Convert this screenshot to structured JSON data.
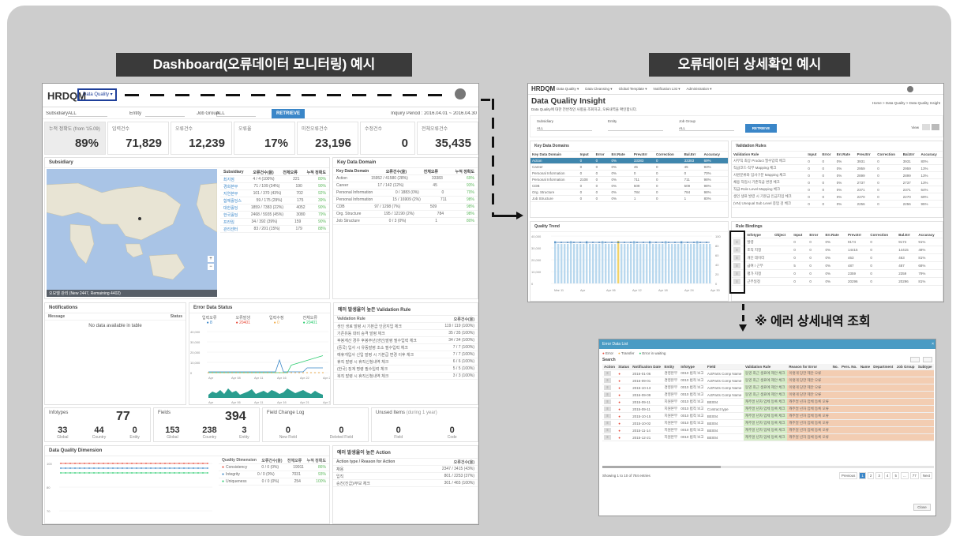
{
  "labels": {
    "left_title": "Dashboard(오류데이터 모니터링) 예시",
    "right_title": "오류데이터 상세확인 예시",
    "error_detail": "※ 에러 상세내역 조회"
  },
  "dashboard": {
    "logo": "HRDQM",
    "menu_selected": "Data Quality",
    "filters": {
      "subsidiary_label": "Subsidiary",
      "subsidiary_value": "ALL",
      "entity_label": "Entity",
      "jobgroup_label": "Job Group",
      "jobgroup_value": "ALL",
      "retrieve": "RETRIEVE",
      "period": "Inquiry Period : 2016.04.01 ~ 2016.04.30"
    },
    "kpis": [
      {
        "label": "누적 정확도 (from '15.09)",
        "value": "89%"
      },
      {
        "label": "입력건수",
        "value": "71,829"
      },
      {
        "label": "오류건수",
        "value": "12,239"
      },
      {
        "label": "오류율",
        "value": "17%"
      },
      {
        "label": "미전오류건수",
        "value": "23,196"
      },
      {
        "label": "수정건수",
        "value": "0"
      },
      {
        "label": "전체오류건수",
        "value": "35,435"
      }
    ],
    "subsidiary_panel": "Subsidiary",
    "map_status": "오모델 관리 (New 2447, Remaining 4402)",
    "subsidiary_table": {
      "headers": [
        "Subsidiary",
        "오류건수(율)",
        "전체오류",
        "누적 정확도"
      ],
      "rows": [
        [
          "최지점",
          "4 / 4 (100%)",
          "221",
          "80%"
        ],
        [
          "경희본부",
          "71 / 109 (34%)",
          "190",
          "90%"
        ],
        [
          "지연본부",
          "101 / 370 (43%)",
          "702",
          "92%"
        ],
        [
          "함께홀딩스",
          "59 / 175 (29%)",
          "175",
          "39%"
        ],
        [
          "대한홀딩",
          "1859 / 7383 (22%)",
          "4052",
          "90%"
        ],
        [
          "한국홀딩",
          "2468 / 5935 (45%)",
          "3080",
          "79%"
        ],
        [
          "프라임",
          "34 / 392 (39%)",
          "159",
          "90%"
        ],
        [
          "관리센터",
          "83 / 201 (15%)",
          "179",
          "88%"
        ]
      ]
    },
    "key_domain_panel": "Key Data Domain",
    "key_domain_table": {
      "headers": [
        "Key Data Domain",
        "오류건수(율)",
        "전체오류",
        "누적 정확도"
      ],
      "rows": [
        [
          "Action",
          "15952 / 41580 (28%)",
          "33383",
          "69%"
        ],
        [
          "Career",
          "17 / 142 (12%)",
          "45",
          "93%"
        ],
        [
          "Personal Information",
          "0 / 1883 (0%)",
          "0",
          "70%"
        ],
        [
          "Personal Information",
          "15 / 16909 (2%)",
          "711",
          "98%"
        ],
        [
          "CDB",
          "97 / 1298 (7%)",
          "509",
          "98%"
        ],
        [
          "Org. Structure",
          "195 / 12190 (2%)",
          "784",
          "98%"
        ],
        [
          "Job Structure",
          "0 / 3 (0%)",
          "1",
          "80%"
        ]
      ]
    },
    "notifications": {
      "title": "Notifications",
      "col1": "Message",
      "col2": "Status",
      "empty": "No data available in table"
    },
    "error_status": {
      "title": "Error Data Status",
      "legend": [
        {
          "name": "입력오류",
          "value": "8",
          "color": "#3a86c8"
        },
        {
          "name": "오류발생",
          "value": "20401",
          "color": "#e74c3c"
        },
        {
          "name": "입력수정",
          "value": "0",
          "color": "#f0ad4e"
        },
        {
          "name": "전체오류",
          "value": "20401",
          "color": "#2ecc71"
        }
      ],
      "yticks": [
        "40,000",
        "30,000",
        "20,000",
        "10,000",
        "0"
      ],
      "xticks": [
        "Apr",
        "Apr 08",
        "Apr 11",
        "Apr 16",
        "Apr 22",
        "Apr 28"
      ],
      "xticks2": [
        "Apr",
        "Apr 06",
        "Apr 11",
        "Apr 16",
        "Apr 21",
        "Apr 26"
      ]
    },
    "validation": {
      "title": "예러 발생율이 높은 Validation Rule",
      "col1": "Validation Rule",
      "col2": "오류건수(율)",
      "rows": [
        [
          "생인 생료 발령 시 기본급 인금지입 체크",
          "119 / 119 (100%)"
        ],
        [
          "기존유동 대비 승격 발령 체크",
          "35 / 35 (100%)"
        ],
        [
          "후봉계산 경우 후봉주년(생인)발령 필수입력 체크",
          "34 / 34 (100%)"
        ],
        [
          "(중국) 입사 시 유동발령 조소 필수입력 체크",
          "7 / 7 (100%)"
        ],
        [
          "예휴개입사 신입 발령 시 기본급 변경 이후 체크",
          "7 / 7 (100%)"
        ],
        [
          "휴직 발령 시 휴직신청내역 체크",
          "6 / 6 (100%)"
        ],
        [
          "(한국) 징계 명령 필수입력 체크",
          "5 / 5 (100%)"
        ],
        [
          "복직 발령 시 휴직신청내역 체크",
          "3 / 3 (100%)"
        ]
      ]
    },
    "infotypes": {
      "title": "Infotypes",
      "big": "77",
      "items": [
        {
          "v": "33",
          "l": "Global"
        },
        {
          "v": "44",
          "l": "Country"
        },
        {
          "v": "0",
          "l": "Entity"
        }
      ]
    },
    "fields": {
      "title": "Fields",
      "big": "394",
      "items": [
        {
          "v": "153",
          "l": "Global"
        },
        {
          "v": "238",
          "l": "Country"
        },
        {
          "v": "3",
          "l": "Entity"
        }
      ]
    },
    "field_change": {
      "title": "Field Change Log",
      "items": [
        {
          "v": "0",
          "l": "New Field"
        },
        {
          "v": "0",
          "l": "Deleted Field"
        }
      ]
    },
    "unused": {
      "title": "Unused Items",
      "note": "(during 1 year)",
      "items": [
        {
          "v": "0",
          "l": "Field"
        },
        {
          "v": "0",
          "l": "Code"
        }
      ]
    },
    "dq_dimension": {
      "title": "Data Quality Dimension",
      "yticks": [
        "100",
        "80",
        "70"
      ],
      "headers": [
        "Quality Dimension",
        "오류건수(율)",
        "전체오류",
        "누적 정확도"
      ],
      "rows": [
        [
          "Consistency",
          "0 / 0 (0%)",
          "19911",
          "86%",
          "#e74c3c"
        ],
        [
          "Integrity",
          "0 / 0 (0%)",
          "7031",
          "93%",
          "#3a86c8"
        ],
        [
          "Uniqueness",
          "0 / 0 (0%)",
          "254",
          "100%",
          "#2ecc71"
        ]
      ]
    },
    "action_panel": {
      "title": "예러 발생율이 높은 Action",
      "col1": "Action type / Reason for Action",
      "col2": "오류건수(율)",
      "rows": [
        [
          "채용",
          "2347 / 3415 (43%)"
        ],
        [
          "입직",
          "801 / 2253 (37%)"
        ],
        [
          "승진(진급)/무보 체크",
          "301 / 465 (100%)"
        ]
      ]
    }
  },
  "insight": {
    "logo": "HRDQM",
    "nav": [
      "Data Quality",
      "Data Cleansing",
      "Global Template",
      "Notification List",
      "Administration"
    ],
    "title": "Data Quality Insight",
    "subtitle": "Data Quality에 대한 전반적인 사항을 조회하고, 오류내역을 확인합니다.",
    "breadcrumb": "Home > Data Quality > Data Quality Insight",
    "filters": {
      "subsidiary": "Subsidiary",
      "entity": "Entity",
      "jobgroup": "Job Group",
      "all": "ALL",
      "retrieve": "RETRIEVE",
      "view": "View"
    },
    "key_domains": {
      "title": "Key Data Domains",
      "headers": [
        "Key Data Domain",
        "Input",
        "Error",
        "Err.Rate",
        "Prev.Err",
        "Correction",
        "Bal.Err",
        "Accuracy"
      ],
      "rows": [
        [
          "Action",
          "0",
          "0",
          "0%",
          "33383",
          "0",
          "33383",
          "69%"
        ],
        [
          "Career",
          "0",
          "0",
          "0%",
          "45",
          "0",
          "45",
          "93%"
        ],
        [
          "Personal Information",
          "0",
          "0",
          "0%",
          "0",
          "0",
          "0",
          "70%"
        ],
        [
          "Personal Information",
          "2108",
          "0",
          "0%",
          "711",
          "0",
          "711",
          "98%"
        ],
        [
          "CDB",
          "0",
          "0",
          "0%",
          "509",
          "0",
          "509",
          "98%"
        ],
        [
          "Org. Structure",
          "0",
          "0",
          "0%",
          "784",
          "0",
          "784",
          "98%"
        ],
        [
          "Job Structure",
          "0",
          "0",
          "0%",
          "1",
          "0",
          "1",
          "80%"
        ]
      ]
    },
    "validation_rules": {
      "title": "Validation Rules",
      "headers": [
        "Validation Rule",
        "Input",
        "Error",
        "Err.Rate",
        "Prev.Err",
        "Correction",
        "Bal.Err",
        "Accuracy"
      ],
      "rows": [
        [
          "사무직 최상 Product 필수입력 체크",
          "0",
          "0",
          "0%",
          "3931",
          "0",
          "3931",
          "80%"
        ],
        [
          "직급코드-직무 Mapping 체크",
          "0",
          "0",
          "0%",
          "2959",
          "0",
          "2959",
          "13%"
        ],
        [
          "사원분류와 입사구분 Mapping 체크",
          "0",
          "0",
          "0%",
          "2899",
          "0",
          "2899",
          "13%"
        ],
        [
          "채용 작업시 기존직급 변경 체크",
          "0",
          "0",
          "0%",
          "2737",
          "0",
          "2737",
          "13%"
        ],
        [
          "직급-Role Level Mapping 체크",
          "0",
          "0",
          "0%",
          "2371",
          "0",
          "2371",
          "64%"
        ],
        [
          "생인 생료 발령 시 기본급 인금지입 체크",
          "0",
          "0",
          "0%",
          "2270",
          "0",
          "2270",
          "69%"
        ],
        [
          "(VN) Unequal Sub Level 종업 검 체크",
          "0",
          "0",
          "0%",
          "2256",
          "0",
          "2256",
          "95%"
        ]
      ]
    },
    "quality_trend": {
      "title": "Quality Trend",
      "yticks": [
        "40,000",
        "30,000",
        "20,000",
        "10,000",
        "0"
      ],
      "y2ticks": [
        "100",
        "80",
        "60",
        "40",
        "20",
        "0"
      ],
      "xticks": [
        "Mar 11",
        "Apr",
        "Apr 06",
        "Apr 12",
        "Apr 18",
        "Apr 24",
        "Apr 30"
      ]
    },
    "rule_bindings": {
      "title": "Rule Bindings",
      "headers": [
        "Infotype",
        "Object",
        "Input",
        "Error",
        "Err.Rate",
        "Prev.Err",
        "Correction",
        "Bal.Err",
        "Accuracy"
      ],
      "rows": [
        [
          "발령",
          "",
          "0",
          "0",
          "0%",
          "9174",
          "0",
          "9174",
          "91%"
        ],
        [
          "조직 지정",
          "",
          "0",
          "0",
          "0%",
          "14415",
          "0",
          "14415",
          "48%"
        ],
        [
          "개인 데이터",
          "",
          "0",
          "0",
          "0%",
          "463",
          "0",
          "463",
          "81%"
        ],
        [
          "급여 / 근무",
          "",
          "5",
          "0",
          "0%",
          "487",
          "0",
          "487",
          "68%"
        ],
        [
          "평가 지정",
          "",
          "0",
          "0",
          "0%",
          "2359",
          "0",
          "2359",
          "79%"
        ],
        [
          "근무일정",
          "",
          "0",
          "0",
          "0%",
          "20296",
          "0",
          "20296",
          "81%"
        ]
      ]
    }
  },
  "error_list": {
    "title": "Error Data List",
    "legend": [
      "Error",
      "Transfer",
      "Error in waiting"
    ],
    "search": "Search",
    "headers": [
      "Action",
      "Status",
      "Notification Date",
      "Entity",
      "Infotype",
      "Field",
      "Validation Rule",
      "Reason for Error",
      "No.",
      "Pers. No.",
      "Name",
      "Department",
      "Job Group",
      "Subtype"
    ],
    "rows": [
      [
        "2016-01-06",
        "경영본부",
        "0010 법적 보고",
        "ActParts Comp Name",
        "동영 최근 생료에 제안 체크",
        "이렇게 당한 제안 오류"
      ],
      [
        "2016-09-01",
        "경영본부",
        "0010 법적 보고",
        "ActParts Comp Name",
        "동영 최근 생료에 제안 체크",
        "이렇게 당한 제안 오류"
      ],
      [
        "2015-10-13",
        "경영본부",
        "0010 법적 보고",
        "ActParts Comp Name",
        "동영 최근 생료에 제안 체크",
        "이렇게 당한 제안 오류"
      ],
      [
        "2016-09-09",
        "경영본부",
        "0010 법적 보고",
        "ActParts Comp Name",
        "동영 최근 생료에 제안 체크",
        "이렇게 당한 제안 오류"
      ],
      [
        "2015-09-11",
        "지원본부",
        "0010 법적 보고",
        "BE004",
        "캐주얼 년차 업체 등록 체크",
        "캐주얼 년차 업체 등록 오류"
      ],
      [
        "2015-09-11",
        "지원본부",
        "0010 법적 보고",
        "Contract type",
        "캐주얼 년차 업체 등록 체크",
        "캐주얼 년차 업체 등록 오류"
      ],
      [
        "2015-10-15",
        "지원본부",
        "0010 법적 보고",
        "BE004",
        "캐주얼 년차 업체 등록 체크",
        "캐주얼 년차 업체 등록 오류"
      ],
      [
        "2015-10-02",
        "지원본부",
        "0010 법적 보고",
        "BE004",
        "캐주얼 년차 업체 등록 체크",
        "캐주얼 년차 업체 등록 오류"
      ],
      [
        "2015-11-14",
        "지원본부",
        "0010 법적 보고",
        "BE004",
        "캐주얼 년차 업체 등록 체크",
        "캐주얼 년차 업체 등록 오류"
      ],
      [
        "2015-12-21",
        "지원본부",
        "0010 법적 보고",
        "BE004",
        "캐주얼 년차 업체 등록 체크",
        "캐주얼 년차 업체 등록 오류"
      ]
    ],
    "footer": "Showing 1 to 10 of 784 entries",
    "pager": [
      "Previous",
      "1",
      "2",
      "3",
      "4",
      "5",
      "...",
      "77",
      "Next"
    ],
    "close": "Close"
  }
}
